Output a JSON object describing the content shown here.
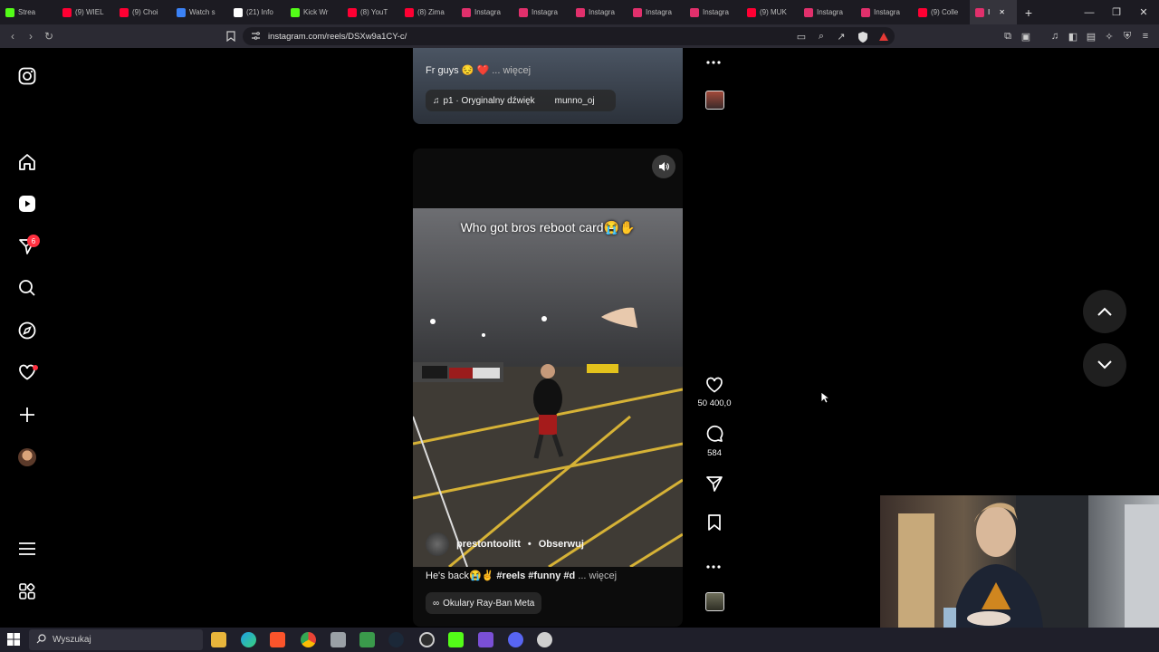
{
  "browser": {
    "tabs": [
      {
        "label": "Strea",
        "color": "#53fc18"
      },
      {
        "label": "(9) WIEL",
        "color": "#ff0033"
      },
      {
        "label": "(9) Choi",
        "color": "#ff0033"
      },
      {
        "label": "Watch s",
        "color": "#3b82f6"
      },
      {
        "label": "(21) Info",
        "color": "#ffffff"
      },
      {
        "label": "Kick Wr",
        "color": "#53fc18"
      },
      {
        "label": "(8) YouT",
        "color": "#ff0033"
      },
      {
        "label": "(8) Zima",
        "color": "#ff0033"
      },
      {
        "label": "Instagra",
        "color": "#e1306c"
      },
      {
        "label": "Instagra",
        "color": "#e1306c"
      },
      {
        "label": "Instagra",
        "color": "#e1306c"
      },
      {
        "label": "Instagra",
        "color": "#e1306c"
      },
      {
        "label": "Instagra",
        "color": "#e1306c"
      },
      {
        "label": "(9) MUK",
        "color": "#ff0033"
      },
      {
        "label": "Instagra",
        "color": "#e1306c"
      },
      {
        "label": "Instagra",
        "color": "#e1306c"
      },
      {
        "label": "(9) Colle",
        "color": "#ff0033"
      },
      {
        "label": "I",
        "color": "#e1306c",
        "active": true
      }
    ],
    "url": "instagram.com/reels/DSXw9a1CY-c/"
  },
  "sidebar": {
    "notification_count": "6",
    "icons": [
      "instagram-logo-icon",
      "home-icon",
      "reels-icon",
      "messages-icon",
      "search-icon",
      "explore-icon",
      "notifications-icon",
      "create-icon",
      "profile-avatar",
      "menu-icon",
      "more-apps-icon"
    ]
  },
  "reel_prev": {
    "caption": "Fr guys 😔 ❤️",
    "more": "... więcej",
    "audio": "p1 · Oryginalny dźwięk",
    "audio_user": "munno_oj"
  },
  "reel": {
    "overlay_text": "Who got bros reboot card😭✋",
    "username": "prestontoolitt",
    "follow": "Obserwuj",
    "caption": "He's back😭✌️",
    "hashtags": "#reels #funny #d",
    "more": "... więcej",
    "chip": "Okulary Ray-Ban Meta",
    "likes": "50 400,0",
    "comments": "584"
  },
  "taskbar": {
    "search_placeholder": "Wyszukaj"
  }
}
